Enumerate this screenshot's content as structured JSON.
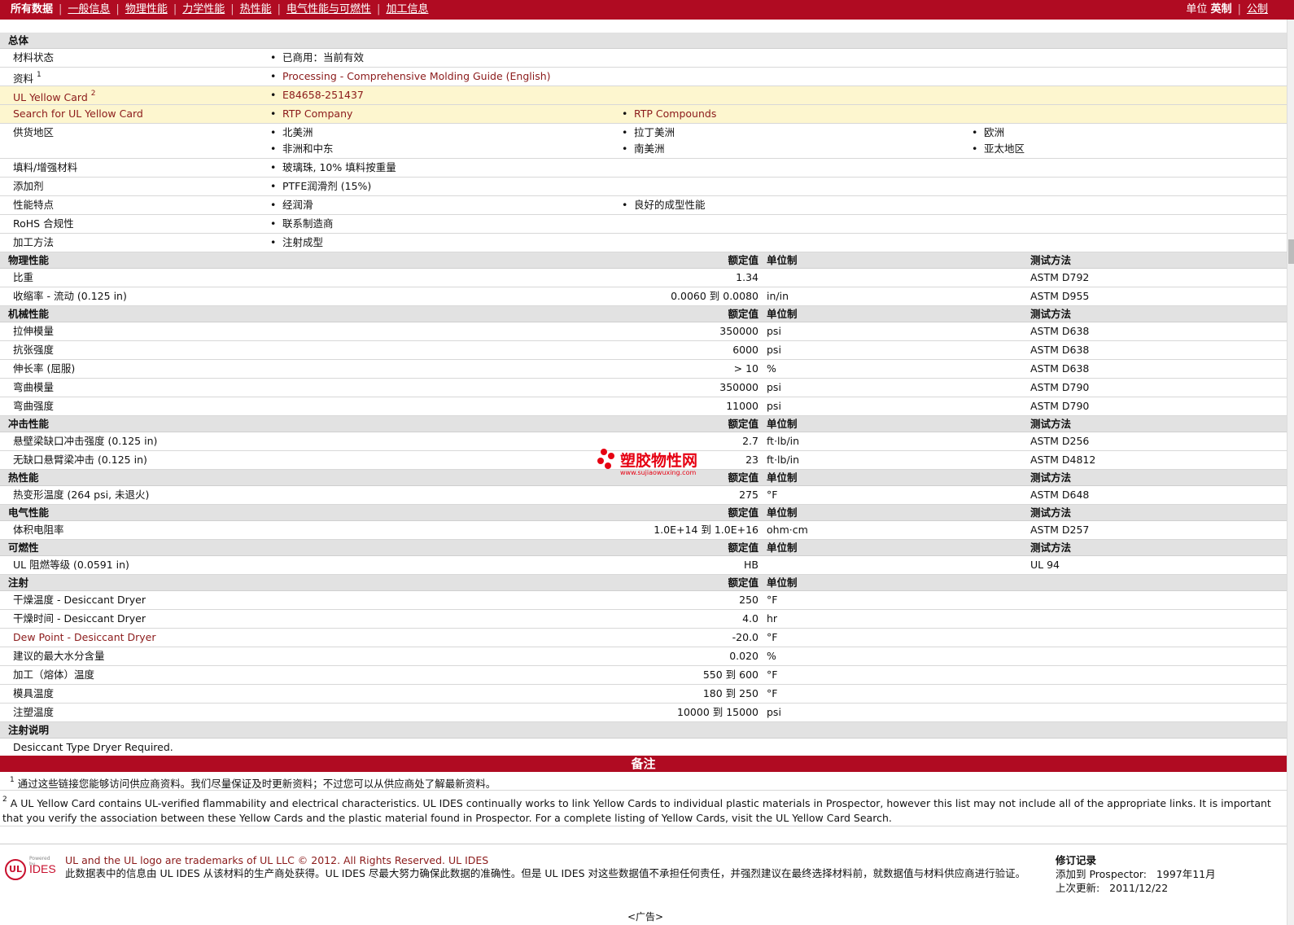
{
  "nav": {
    "tabs": [
      "所有数据",
      "一般信息",
      "物理性能",
      "力学性能",
      "热性能",
      "电气性能与可燃性",
      "加工信息"
    ],
    "units_label": "单位",
    "unit_english": "英制",
    "unit_metric": "公制"
  },
  "general": {
    "header": "总体",
    "material_status_label": "材料状态",
    "material_status_value": "已商用：当前有效",
    "literature_label": "资料",
    "literature_sup": "1",
    "literature_value": "Processing - Comprehensive Molding Guide (English)",
    "yellow_card_label": "UL Yellow Card",
    "yellow_card_sup": "2",
    "yellow_card_value": "E84658-251437",
    "search_label": "Search for UL Yellow Card",
    "search_links": [
      "RTP Company",
      "RTP Compounds"
    ],
    "availability_label": "供货地区",
    "availability": [
      "北美洲",
      "拉丁美洲",
      "欧洲",
      "非洲和中东",
      "南美洲",
      "亚太地区"
    ],
    "filler_label": "填料/增强材料",
    "filler_value": "玻璃珠, 10% 填料按重量",
    "additive_label": "添加剂",
    "additive_value": "PTFE润滑剂 (15%)",
    "features_label": "性能特点",
    "features": [
      "经润滑",
      "良好的成型性能"
    ],
    "rohs_label": "RoHS 合规性",
    "rohs_value": "联系制造商",
    "process_label": "加工方法",
    "process_value": "注射成型"
  },
  "col_headers": {
    "value": "额定值",
    "unit": "单位制",
    "test": "测试方法"
  },
  "physical": {
    "header": "物理性能",
    "rows": [
      {
        "label": "比重",
        "value": "1.34",
        "unit": "",
        "test": "ASTM D792"
      },
      {
        "label": "收缩率 - 流动 (0.125 in)",
        "value": "0.0060 到 0.0080",
        "unit": "in/in",
        "test": "ASTM D955"
      }
    ]
  },
  "mechanical": {
    "header": "机械性能",
    "rows": [
      {
        "label": "拉伸模量",
        "value": "350000",
        "unit": "psi",
        "test": "ASTM D638"
      },
      {
        "label": "抗张强度",
        "value": "6000",
        "unit": "psi",
        "test": "ASTM D638"
      },
      {
        "label": "伸长率 (屈服)",
        "value": "> 10",
        "unit": "%",
        "test": "ASTM D638"
      },
      {
        "label": "弯曲模量",
        "value": "350000",
        "unit": "psi",
        "test": "ASTM D790"
      },
      {
        "label": "弯曲强度",
        "value": "11000",
        "unit": "psi",
        "test": "ASTM D790"
      }
    ]
  },
  "impact": {
    "header": "冲击性能",
    "rows": [
      {
        "label": "悬壁梁缺口冲击强度 (0.125 in)",
        "value": "2.7",
        "unit": "ft·lb/in",
        "test": "ASTM D256"
      },
      {
        "label": "无缺口悬臂梁冲击 (0.125 in)",
        "value": "23",
        "unit": "ft·lb/in",
        "test": "ASTM D4812"
      }
    ]
  },
  "thermal": {
    "header": "热性能",
    "rows": [
      {
        "label": "热变形温度 (264 psi, 未退火)",
        "value": "275",
        "unit": "°F",
        "test": "ASTM D648"
      }
    ]
  },
  "electrical": {
    "header": "电气性能",
    "rows": [
      {
        "label": "体积电阻率",
        "value": "1.0E+14 到 1.0E+16",
        "unit": "ohm·cm",
        "test": "ASTM D257"
      }
    ]
  },
  "flammability": {
    "header": "可燃性",
    "rows": [
      {
        "label": "UL 阻燃等级 (0.0591 in)",
        "value": "HB",
        "unit": "",
        "test": "UL 94"
      }
    ]
  },
  "injection": {
    "header": "注射",
    "rows": [
      {
        "label": "干燥温度 - Desiccant Dryer",
        "value": "250",
        "unit": "°F"
      },
      {
        "label": "干燥时间 - Desiccant Dryer",
        "value": "4.0",
        "unit": "hr"
      },
      {
        "label": "Dew Point - Desiccant Dryer",
        "value": "-20.0",
        "unit": "°F"
      },
      {
        "label": "建议的最大水分含量",
        "value": "0.020",
        "unit": "%"
      },
      {
        "label": "加工（熔体）温度",
        "value": "550 到 600",
        "unit": "°F"
      },
      {
        "label": "模具温度",
        "value": "180 到 250",
        "unit": "°F"
      },
      {
        "label": "注塑温度",
        "value": "10000 到 15000",
        "unit": "psi"
      }
    ]
  },
  "injection_notes": {
    "header": "注射说明",
    "text": "Desiccant Type Dryer Required."
  },
  "notes": {
    "header": "备注",
    "note1_sup": "1",
    "note1": "通过这些链接您能够访问供应商资料。我们尽量保证及时更新资料；不过您可以从供应商处了解最新资料。",
    "note2_sup": "2",
    "note2": "A UL Yellow Card contains UL-verified flammability and electrical characteristics. UL IDES continually works to link Yellow Cards to individual plastic materials in Prospector, however this list may not include all of the appropriate links. It is important that you verify the association between these Yellow Cards and the plastic material found in Prospector. For a complete listing of Yellow Cards, visit the UL Yellow Card Search."
  },
  "footer": {
    "logo_powered": "Powered by",
    "logo_ul": "UL",
    "logo_ides": "IDES",
    "trademark": "UL and the UL logo are trademarks of UL LLC © 2012. All Rights Reserved. UL IDES",
    "disclaimer": "此数据表中的信息由 UL IDES 从该材料的生产商处获得。UL IDES 尽最大努力确保此数据的准确性。但是 UL IDES 对这些数据值不承担任何责任，并强烈建议在最终选择材料前，就数据值与材料供应商进行验证。",
    "revision_title": "修订记录",
    "added_label": "添加到 Prospector:",
    "added_value": "1997年11月",
    "updated_label": "上次更新:",
    "updated_value": "2011/12/22"
  },
  "ad_label": "<广告>",
  "watermark": {
    "name": "塑胶物性网",
    "url": "www.sujiaowuxing.com"
  }
}
